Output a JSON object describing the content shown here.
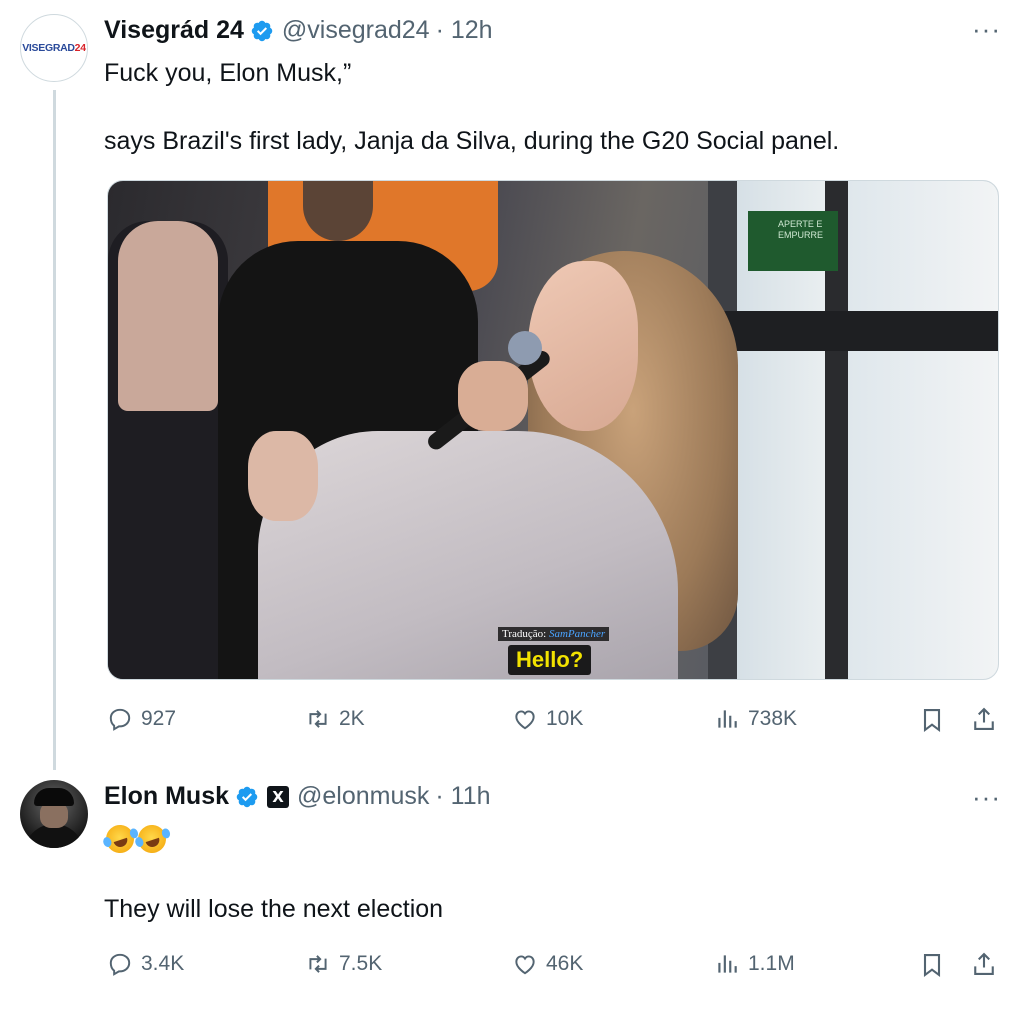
{
  "tweet1": {
    "avatar_text_blue": "VISEGRAD",
    "avatar_text_red": "24",
    "name": "Visegrád 24",
    "handle": "@visegrad24",
    "time": "· 12h",
    "more": "···",
    "text_line1": "Fuck you, Elon Musk,”",
    "text_line2": "says Brazil's first lady, Janja da Silva, during the G20 Social panel.",
    "media": {
      "credit_label": "Tradução:",
      "credit_name": "SamPancher",
      "subtitle": "Hello?",
      "sign_text": "APERTE E EMPURRE"
    },
    "actions": {
      "replies": "927",
      "reposts": "2K",
      "likes": "10K",
      "views": "738K"
    }
  },
  "tweet2": {
    "name": "Elon Musk",
    "affiliation_badge": "X",
    "handle": "@elonmusk",
    "time": "· 11h",
    "more": "···",
    "emoji_count": 2,
    "text": "They will lose the next election",
    "actions": {
      "replies": "3.4K",
      "reposts": "7.5K",
      "likes": "46K",
      "views": "1.1M"
    }
  },
  "colors": {
    "verified": "#1d9bf0",
    "secondary_text": "#536471",
    "primary_text": "#0f1419",
    "subtitle_yellow": "#f2e200"
  },
  "icons": [
    "reply-icon",
    "repost-icon",
    "like-icon",
    "views-icon",
    "bookmark-icon",
    "share-icon",
    "verified-icon"
  ]
}
